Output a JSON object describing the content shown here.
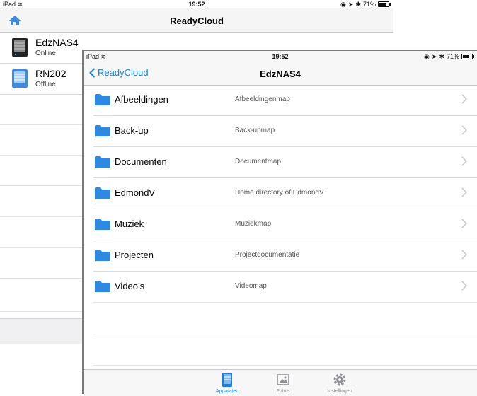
{
  "back_screen": {
    "status": {
      "device": "iPad",
      "time": "19:52",
      "battery": "71%"
    },
    "title": "ReadyCloud",
    "devices": [
      {
        "name": "EdzNAS4",
        "status": "Online"
      },
      {
        "name": "RN202",
        "status": "Offline"
      }
    ]
  },
  "front_screen": {
    "status": {
      "device": "iPad",
      "time": "19:52",
      "battery": "71%"
    },
    "back_label": "ReadyCloud",
    "title": "EdzNAS4",
    "folders": [
      {
        "name": "Afbeeldingen",
        "description": "Afbeeldingenmap"
      },
      {
        "name": "Back-up",
        "description": "Back-upmap"
      },
      {
        "name": "Documenten",
        "description": "Documentmap"
      },
      {
        "name": "EdmondV",
        "description": "Home directory of EdmondV"
      },
      {
        "name": "Muziek",
        "description": "Muziekmap"
      },
      {
        "name": "Projecten",
        "description": "Projectdocumentatie"
      },
      {
        "name": "Video’s",
        "description": "Videomap"
      }
    ],
    "tabs": [
      {
        "label": "Apparaten",
        "icon": "device-icon",
        "active": true
      },
      {
        "label": "Foto’s",
        "icon": "photo-icon",
        "active": false
      },
      {
        "label": "Instellingen",
        "icon": "gear-icon",
        "active": false
      }
    ]
  },
  "colors": {
    "accent": "#1a7fe0",
    "folder": "#2d8ae0",
    "separator": "#dcdce0"
  }
}
